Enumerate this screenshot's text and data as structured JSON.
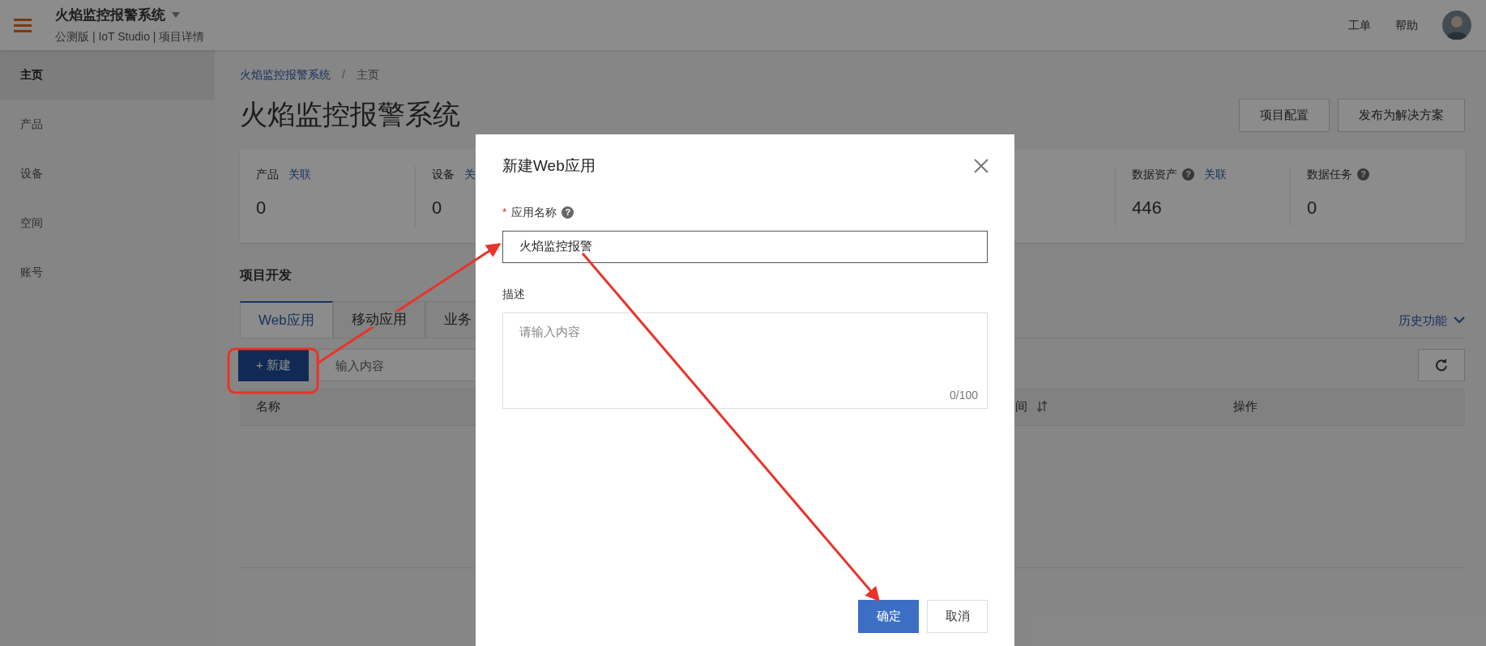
{
  "header": {
    "title": "火焰监控报警系统",
    "subtitle": "公测版 | IoT Studio | 项目详情",
    "links": [
      "工单",
      "帮助"
    ]
  },
  "sidebar": {
    "items": [
      {
        "label": "主页",
        "selected": true
      },
      {
        "label": "产品",
        "selected": false
      },
      {
        "label": "设备",
        "selected": false
      },
      {
        "label": "空间",
        "selected": false
      },
      {
        "label": "账号",
        "selected": false
      }
    ]
  },
  "breadcrumb": {
    "items": [
      "火焰监控报警系统",
      "主页"
    ],
    "separator": "/"
  },
  "page_title": "火焰监控报警系统",
  "actions": [
    "项目配置",
    "发布为解决方案"
  ],
  "stats": [
    {
      "label": "产品",
      "link": "关联",
      "value": "0"
    },
    {
      "label": "设备",
      "link": "关",
      "value": "0"
    },
    {
      "label": "数据资产",
      "help": "?",
      "link": "关联",
      "value": "446"
    },
    {
      "label": "数据任务",
      "help": "?",
      "value": "0"
    }
  ],
  "section_title": "项目开发",
  "tabs": [
    {
      "label": "Web应用",
      "selected": true
    },
    {
      "label": "移动应用",
      "selected": false
    },
    {
      "label": "业务",
      "selected": false
    }
  ],
  "history_link": "历史功能",
  "toolbar": {
    "new_button": "+ 新建",
    "search_placeholder": "输入内容"
  },
  "table": {
    "columns": [
      {
        "label": "名称",
        "sortable": false
      },
      {
        "label": "间",
        "sortable": true
      },
      {
        "label": "操作",
        "sortable": false
      }
    ]
  },
  "dialog": {
    "title": "新建Web应用",
    "fields": [
      {
        "kind": "input",
        "label": "应用名称",
        "required": "*",
        "help": "?",
        "value": "火焰监控报警"
      },
      {
        "kind": "textarea",
        "label": "描述",
        "placeholder": "请输入内容",
        "counter": "0/100"
      }
    ],
    "buttons": [
      {
        "label": "确定",
        "kind": "primary"
      },
      {
        "label": "取消",
        "kind": "secondary"
      }
    ]
  }
}
